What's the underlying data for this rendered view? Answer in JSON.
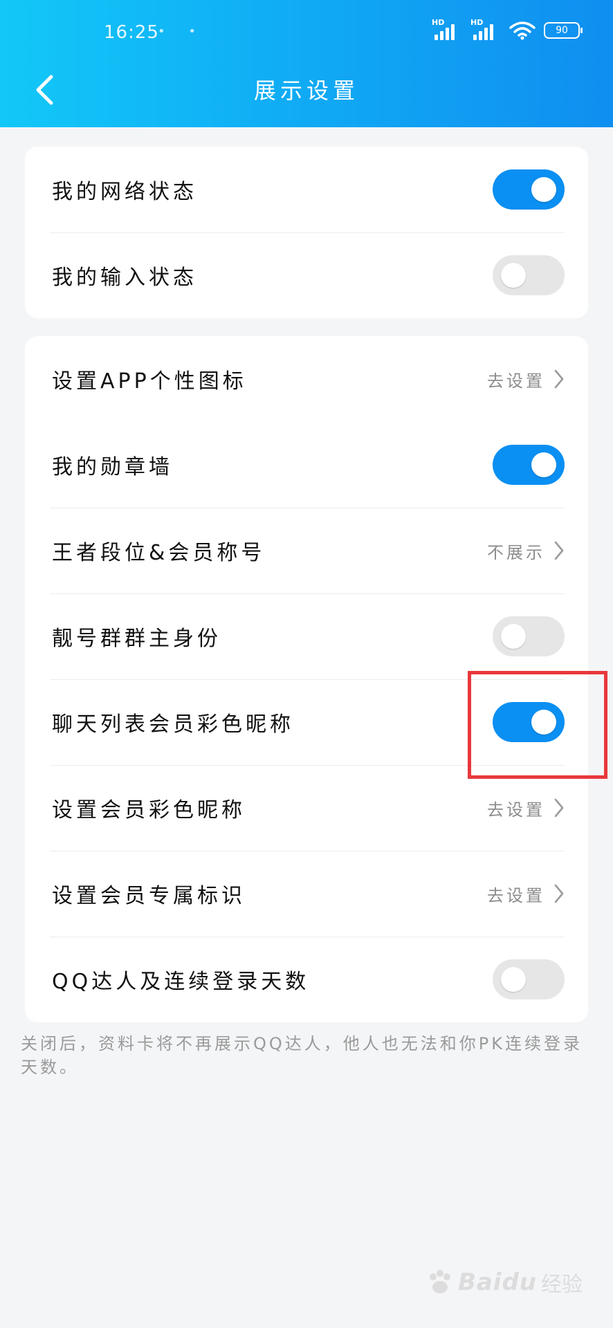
{
  "status_bar": {
    "time": "16:25",
    "extra_indicators": "• •",
    "signal1_label": "HD",
    "signal2_label": "HD",
    "battery": "90"
  },
  "header": {
    "title": "展示设置"
  },
  "group1": [
    {
      "label": "我的网络状态",
      "toggle": true
    },
    {
      "label": "我的输入状态",
      "toggle": false
    }
  ],
  "group2": [
    {
      "label": "设置APP个性图标",
      "value": "去设置"
    }
  ],
  "group3": [
    {
      "label": "我的勋章墙",
      "toggle": true
    },
    {
      "label": "王者段位&会员称号",
      "value": "不展示"
    },
    {
      "label": "靓号群群主身份",
      "toggle": false
    },
    {
      "label": "聊天列表会员彩色昵称",
      "toggle": true
    },
    {
      "label": "设置会员彩色昵称",
      "value": "去设置"
    },
    {
      "label": "设置会员专属标识",
      "value": "去设置"
    },
    {
      "label": "QQ达人及连续登录天数",
      "toggle": false
    }
  ],
  "footnote": "关闭后，资料卡将不再展示QQ达人，他人也无法和你PK连续登录天数。",
  "watermark": {
    "text": "Baidu",
    "sub": "经验"
  },
  "colors": {
    "accent": "#0a8ff2",
    "toggle_off": "#e6e6e6",
    "highlight": "#e8383b"
  }
}
